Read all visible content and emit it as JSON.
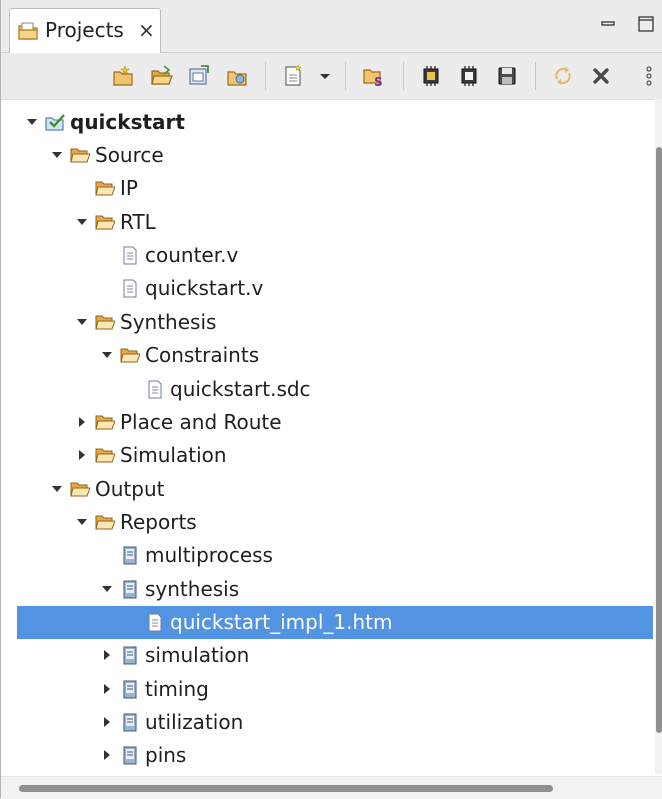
{
  "panel": {
    "tab_label": "Projects",
    "tab_close": "×"
  },
  "icons": {
    "tab": "projects-icon",
    "toolbar": [
      "new-project-icon",
      "open-project-icon",
      "import-project-icon",
      "export-project-icon",
      "new-file-icon",
      "dropdown-arrow-icon",
      "synthesis-icon",
      "generate-bitstream-icon",
      "run-flow-icon",
      "save-bitstream-icon",
      "refresh-icon",
      "remove-icon",
      "view-menu-icon"
    ]
  },
  "tree": [
    {
      "label": "quickstart",
      "icon": "project",
      "bold": true,
      "toggle": "open"
    },
    {
      "label": "Source",
      "icon": "folder",
      "toggle": "open"
    },
    {
      "label": "IP",
      "icon": "folder",
      "toggle": "none"
    },
    {
      "label": "RTL",
      "icon": "folder",
      "toggle": "open"
    },
    {
      "label": "counter.v",
      "icon": "file",
      "toggle": "none"
    },
    {
      "label": "quickstart.v",
      "icon": "file",
      "toggle": "none"
    },
    {
      "label": "Synthesis",
      "icon": "folder",
      "toggle": "open"
    },
    {
      "label": "Constraints",
      "icon": "folder",
      "toggle": "open"
    },
    {
      "label": "quickstart.sdc",
      "icon": "file",
      "toggle": "none"
    },
    {
      "label": "Place and Route",
      "icon": "folder",
      "toggle": "closed"
    },
    {
      "label": "Simulation",
      "icon": "folder",
      "toggle": "closed"
    },
    {
      "label": "Output",
      "icon": "folder",
      "toggle": "open"
    },
    {
      "label": "Reports",
      "icon": "folder",
      "toggle": "open"
    },
    {
      "label": "multiprocess",
      "icon": "report",
      "toggle": "none"
    },
    {
      "label": "synthesis",
      "icon": "report",
      "toggle": "open"
    },
    {
      "label": "quickstart_impl_1.htm",
      "icon": "file",
      "toggle": "none",
      "selected": true
    },
    {
      "label": "simulation",
      "icon": "report",
      "toggle": "closed"
    },
    {
      "label": "timing",
      "icon": "report",
      "toggle": "closed"
    },
    {
      "label": "utilization",
      "icon": "report",
      "toggle": "closed"
    },
    {
      "label": "pins",
      "icon": "report",
      "toggle": "closed"
    }
  ],
  "colors": {
    "selection": "#5294e2",
    "folder": "#e8a84a",
    "toolbar_bg": "#ececec"
  }
}
